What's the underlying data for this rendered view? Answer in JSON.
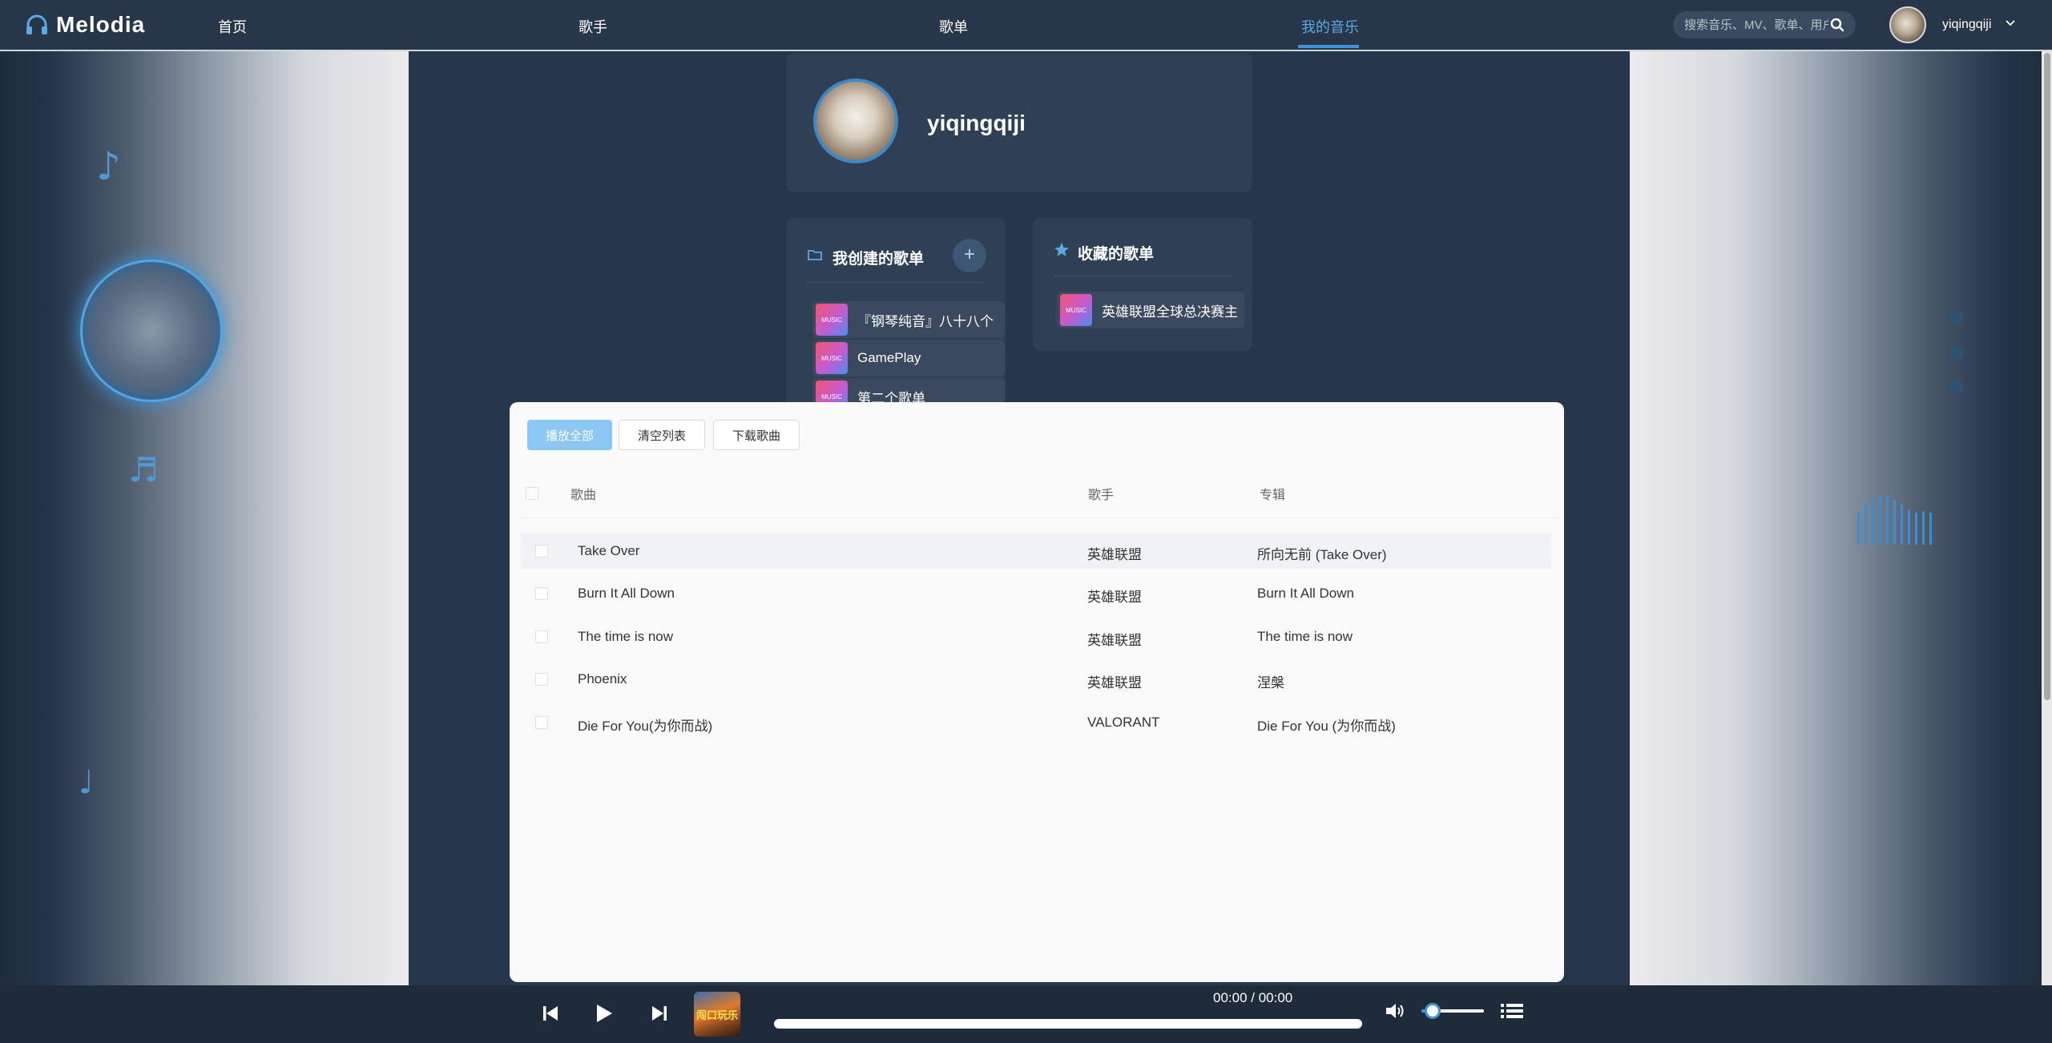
{
  "app": {
    "name": "Melodia"
  },
  "nav": {
    "items": [
      {
        "label": "首页",
        "active": false
      },
      {
        "label": "歌手",
        "active": false
      },
      {
        "label": "歌单",
        "active": false
      },
      {
        "label": "我的音乐",
        "active": true
      }
    ],
    "search_placeholder": "搜索音乐、MV、歌单、用户",
    "user_name": "yiqingqiji"
  },
  "profile": {
    "name": "yiqingqiji"
  },
  "created": {
    "title": "我创建的歌单",
    "add_label": "+",
    "items": [
      {
        "name": "『钢琴纯音』八十八个",
        "badge": "MUSIC"
      },
      {
        "name": "GamePlay",
        "badge": "MUSIC"
      },
      {
        "name": "第二个歌单",
        "badge": "MUSIC"
      }
    ]
  },
  "favorites": {
    "title": "收藏的歌单",
    "items": [
      {
        "name": "英雄联盟全球总决赛主",
        "badge": "MUSIC"
      }
    ]
  },
  "songlist": {
    "buttons": {
      "play_all": "播放全部",
      "clear": "清空列表",
      "download": "下载歌曲"
    },
    "headers": {
      "song": "歌曲",
      "artist": "歌手",
      "album": "专辑"
    },
    "rows": [
      {
        "song": "Take Over",
        "artist": "英雄联盟",
        "album": "所向无前 (Take Over)"
      },
      {
        "song": "Burn It All Down",
        "artist": "英雄联盟",
        "album": "Burn It All Down"
      },
      {
        "song": "The time is now",
        "artist": "英雄联盟",
        "album": "The time is now"
      },
      {
        "song": "Phoenix",
        "artist": "英雄联盟",
        "album": "涅槃"
      },
      {
        "song": "Die For You(为你而战)",
        "artist": "VALORANT",
        "album": "Die For You (为你而战)"
      }
    ]
  },
  "player": {
    "time": "00:00 / 00:00",
    "progress": 0,
    "volume": 0.15,
    "cover_text": "闯口玩乐"
  },
  "colors": {
    "accent": "#3d94dc",
    "bg": "#26364b",
    "primary_button": "#8cc6f5"
  },
  "icons": [
    "headphones-icon",
    "search-icon",
    "chevron-down-icon",
    "folder-icon",
    "star-icon",
    "prev-icon",
    "play-icon",
    "next-icon",
    "volume-icon",
    "playlist-icon",
    "music-note-icon"
  ]
}
